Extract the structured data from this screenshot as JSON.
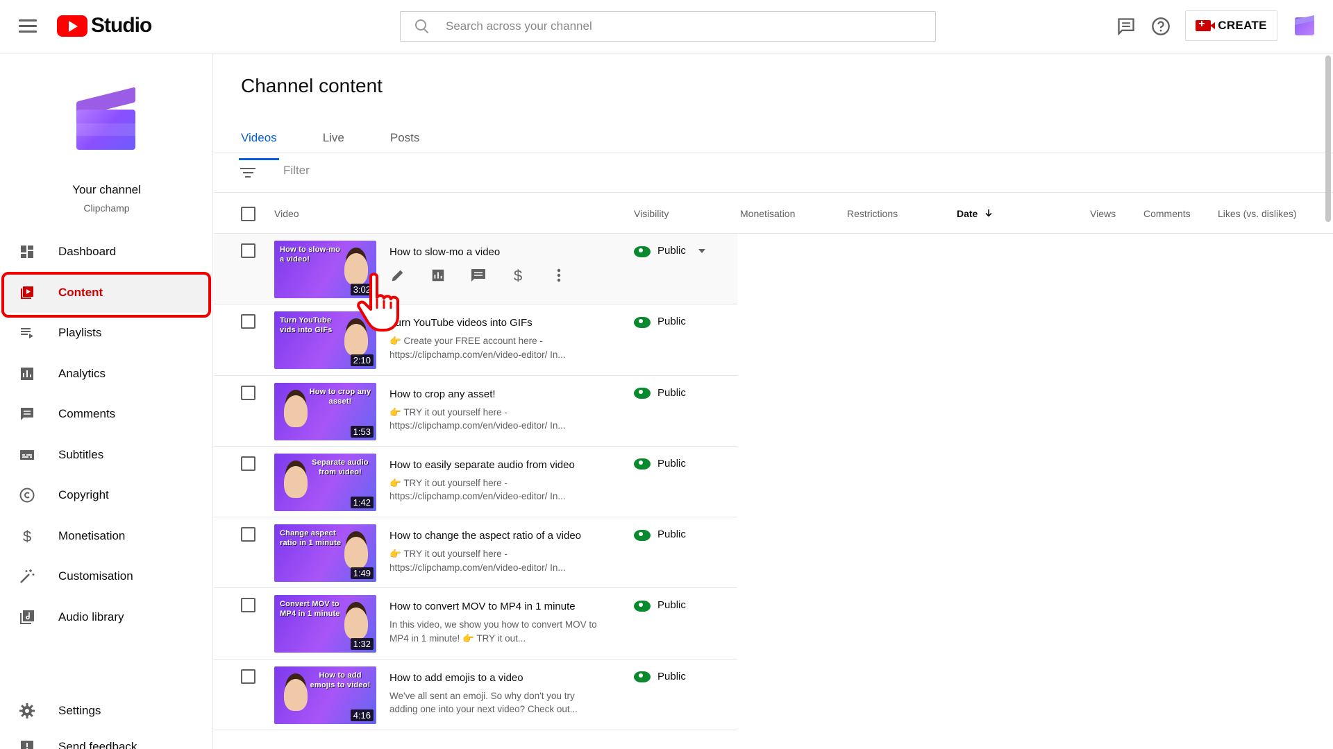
{
  "header": {
    "logo_text": "Studio",
    "search_placeholder": "Search across your channel",
    "create_label": "CREATE"
  },
  "sidebar": {
    "channel_title": "Your channel",
    "channel_name": "Clipchamp",
    "items": [
      {
        "label": "Dashboard",
        "icon": "dashboard-icon"
      },
      {
        "label": "Content",
        "icon": "content-icon",
        "active": true
      },
      {
        "label": "Playlists",
        "icon": "playlists-icon"
      },
      {
        "label": "Analytics",
        "icon": "analytics-icon"
      },
      {
        "label": "Comments",
        "icon": "comments-icon"
      },
      {
        "label": "Subtitles",
        "icon": "subtitles-icon"
      },
      {
        "label": "Copyright",
        "icon": "copyright-icon"
      },
      {
        "label": "Monetisation",
        "icon": "monetisation-icon"
      },
      {
        "label": "Customisation",
        "icon": "customisation-icon"
      },
      {
        "label": "Audio library",
        "icon": "audio-library-icon"
      }
    ],
    "bottom_items": [
      {
        "label": "Settings",
        "icon": "settings-icon"
      },
      {
        "label": "Send feedback",
        "icon": "feedback-icon"
      }
    ]
  },
  "main": {
    "title": "Channel content",
    "tabs": [
      "Videos",
      "Live",
      "Posts"
    ],
    "filter_placeholder": "Filter",
    "columns": {
      "video": "Video",
      "visibility": "Visibility",
      "monetisation": "Monetisation",
      "restrictions": "Restrictions",
      "date": "Date",
      "views": "Views",
      "comments": "Comments",
      "likes": "Likes (vs. dislikes)"
    },
    "videos": [
      {
        "title": "How to slow-mo a video",
        "desc": "",
        "visibility": "Public",
        "duration": "3:02",
        "thumb_text": "How to slow-mo a video!"
      },
      {
        "title": "Turn YouTube videos into GIFs",
        "desc": "👉 Create your FREE account here - https://clipchamp.com/en/video-editor/ In...",
        "visibility": "Public",
        "duration": "2:10",
        "thumb_text": "Turn YouTube vids into GIFs"
      },
      {
        "title": "How to crop any asset!",
        "desc": "👉 TRY it out yourself here - https://clipchamp.com/en/video-editor/ In...",
        "visibility": "Public",
        "duration": "1:53",
        "thumb_text": "How to crop any asset!"
      },
      {
        "title": "How to easily separate audio from video",
        "desc": "👉 TRY it out yourself here - https://clipchamp.com/en/video-editor/ In...",
        "visibility": "Public",
        "duration": "1:42",
        "thumb_text": "Separate audio from video!"
      },
      {
        "title": "How to change the aspect ratio of a video",
        "desc": "👉 TRY it out yourself here - https://clipchamp.com/en/video-editor/ In...",
        "visibility": "Public",
        "duration": "1:49",
        "thumb_text": "Change aspect ratio in 1 minute"
      },
      {
        "title": "How to convert MOV to MP4 in 1 minute",
        "desc": "In this video, we show you how to convert MOV to MP4 in 1 minute! 👉 TRY it out...",
        "visibility": "Public",
        "duration": "1:32",
        "thumb_text": "Convert MOV to MP4 in 1 minute"
      },
      {
        "title": "How to add emojis to a video",
        "desc": "We've all sent an emoji. So why don't you try adding one into your next video? Check out...",
        "visibility": "Public",
        "duration": "4:16",
        "thumb_text": "How to add emojis to video!"
      }
    ]
  },
  "colors": {
    "brand_red": "#ff0000",
    "active_tab_blue": "#065fd4",
    "public_green": "#0a8a2e",
    "highlight_outline": "#ee0000"
  }
}
